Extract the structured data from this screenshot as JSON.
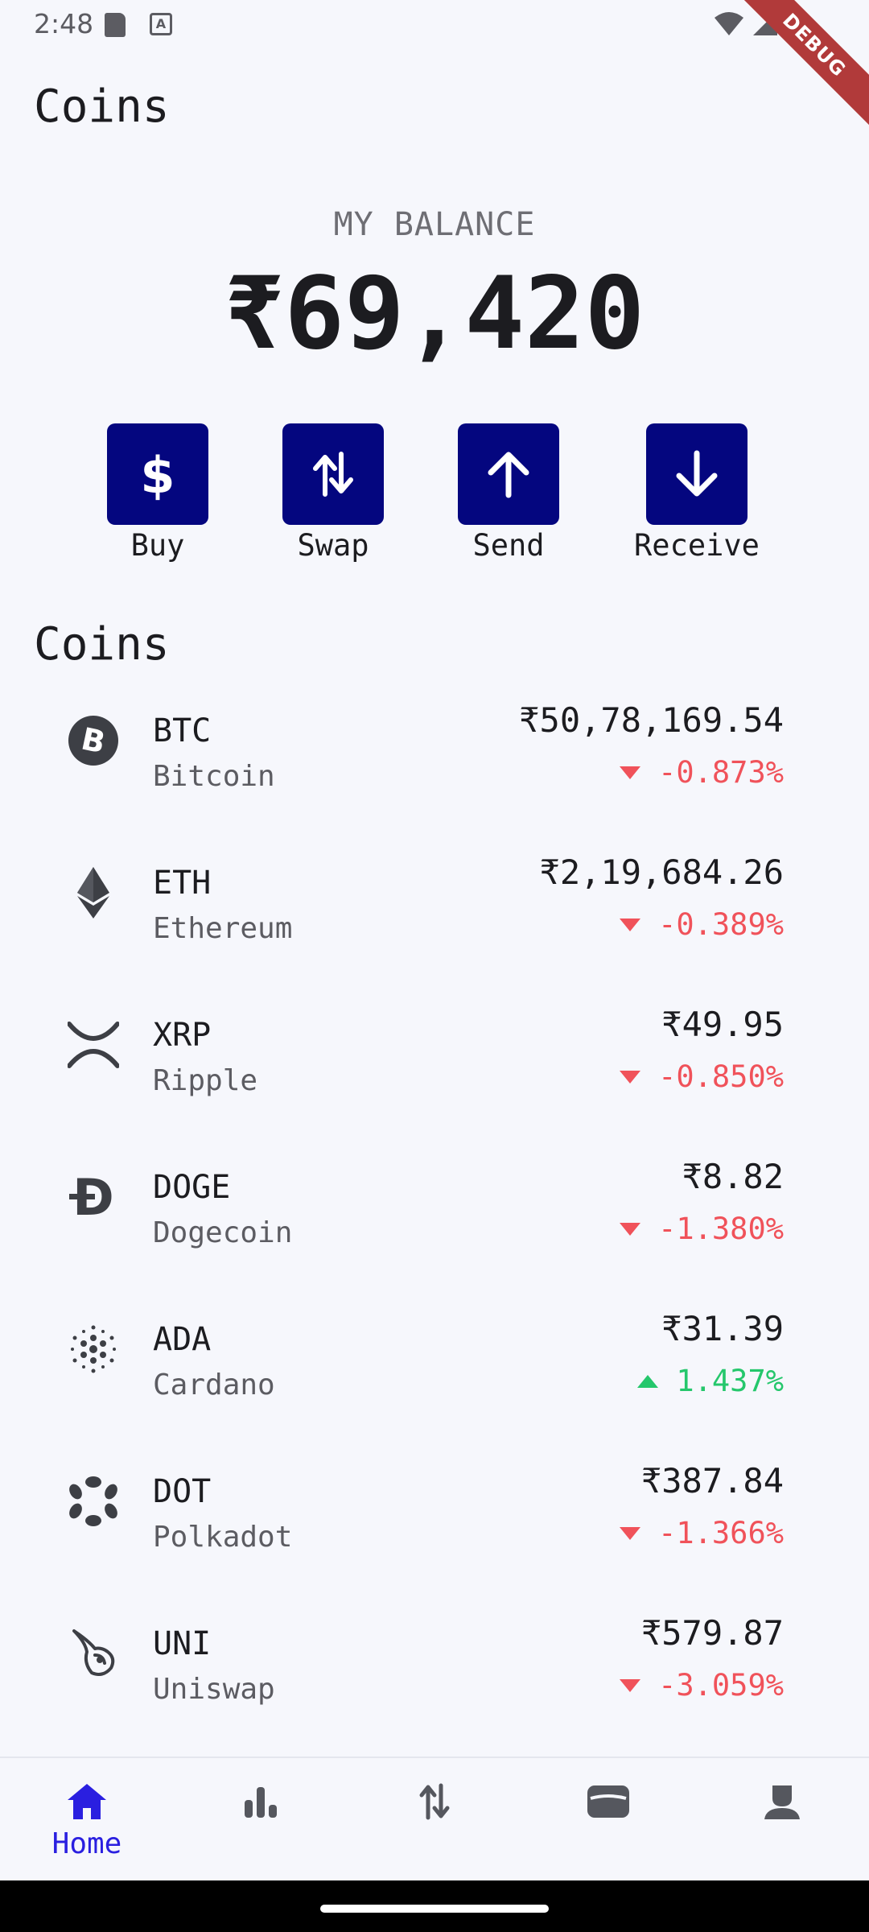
{
  "status_bar": {
    "time": "2:48",
    "debug_label": "DEBUG"
  },
  "header": {
    "title": "Coins"
  },
  "balance": {
    "label": "MY BALANCE",
    "amount": "₹69,420"
  },
  "actions": [
    {
      "label": "Buy",
      "icon": "dollar-icon"
    },
    {
      "label": "Swap",
      "icon": "swap-icon"
    },
    {
      "label": "Send",
      "icon": "arrow-up-icon"
    },
    {
      "label": "Receive",
      "icon": "arrow-down-icon"
    }
  ],
  "coins_section": {
    "title": "Coins"
  },
  "coins": [
    {
      "symbol": "BTC",
      "name": "Bitcoin",
      "price": "₹50,78,169.54",
      "change": "-0.873%",
      "direction": "down",
      "icon": "bitcoin-icon"
    },
    {
      "symbol": "ETH",
      "name": "Ethereum",
      "price": "₹2,19,684.26",
      "change": "-0.389%",
      "direction": "down",
      "icon": "ethereum-icon"
    },
    {
      "symbol": "XRP",
      "name": "Ripple",
      "price": "₹49.95",
      "change": "-0.850%",
      "direction": "down",
      "icon": "ripple-icon"
    },
    {
      "symbol": "DOGE",
      "name": "Dogecoin",
      "price": "₹8.82",
      "change": "-1.380%",
      "direction": "down",
      "icon": "dogecoin-icon"
    },
    {
      "symbol": "ADA",
      "name": "Cardano",
      "price": "₹31.39",
      "change": "1.437%",
      "direction": "up",
      "icon": "cardano-icon"
    },
    {
      "symbol": "DOT",
      "name": "Polkadot",
      "price": "₹387.84",
      "change": "-1.366%",
      "direction": "down",
      "icon": "polkadot-icon"
    },
    {
      "symbol": "UNI",
      "name": "Uniswap",
      "price": "₹579.87",
      "change": "-3.059%",
      "direction": "down",
      "icon": "uniswap-icon"
    }
  ],
  "bottom_nav": {
    "active": "Home",
    "items": [
      {
        "label": "Home",
        "icon": "home-icon"
      },
      {
        "label": "",
        "icon": "bar-chart-icon"
      },
      {
        "label": "",
        "icon": "swap-icon"
      },
      {
        "label": "",
        "icon": "wallet-icon"
      },
      {
        "label": "",
        "icon": "profile-icon"
      }
    ]
  },
  "colors": {
    "accent": "#04067f",
    "nav_active": "#2a1fe0",
    "negative": "#f0525a",
    "positive": "#25c76c",
    "background": "#f6f7fc"
  }
}
